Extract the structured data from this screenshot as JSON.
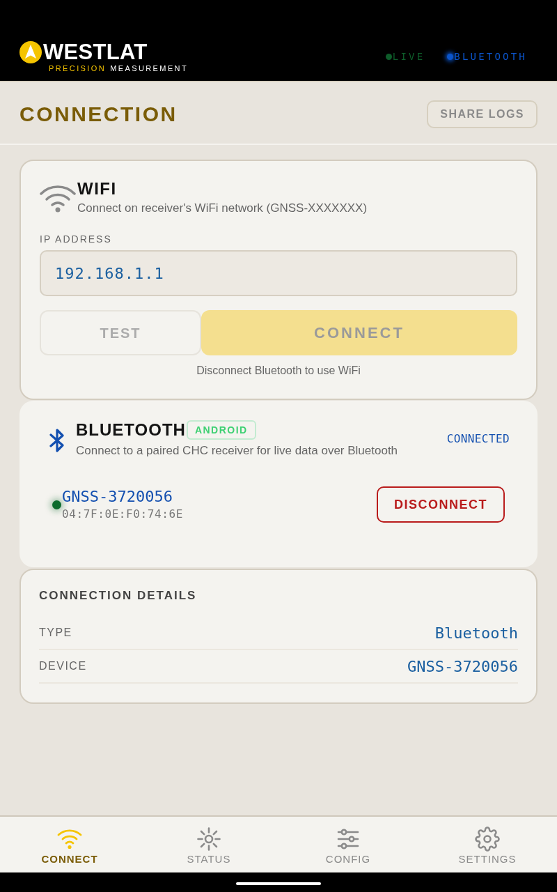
{
  "header": {
    "brand": "WESTLAT",
    "tagline": [
      {
        "text": "PRECISION",
        "accent": true
      },
      {
        "text": "MEASUREMENT",
        "accent": false
      }
    ],
    "indicators": [
      {
        "label": "LIVE",
        "color": "#0e5c2a",
        "active": false
      },
      {
        "label": "BLUETOOTH",
        "color": "#0b55cc",
        "active": true
      }
    ]
  },
  "page": {
    "title": "CONNECTION",
    "share_button": "SHARE LOGS"
  },
  "wifi": {
    "title": "WIFI",
    "description": "Connect on receiver's WiFi network (GNSS-XXXXXXX)",
    "field": {
      "label": "IP ADDRESS",
      "value": "192.168.1.1"
    },
    "buttons": [
      {
        "label": "TEST",
        "kind": "secondary",
        "disabled": true
      },
      {
        "label": "CONNECT",
        "kind": "primary",
        "disabled": true
      }
    ],
    "note": "Disconnect Bluetooth to use WiFi"
  },
  "bluetooth": {
    "title": "BLUETOOTH",
    "badge": "ANDROID",
    "description": "Connect to a paired CHC receiver for live data over Bluetooth",
    "status": "CONNECTED",
    "device": {
      "name": "GNSS-3720056",
      "address": "04:7F:0E:F0:74:6E",
      "connected": true,
      "button": "DISCONNECT"
    }
  },
  "details": {
    "title": "CONNECTION DETAILS",
    "rows": [
      {
        "label": "TYPE",
        "value": "Bluetooth"
      },
      {
        "label": "DEVICE",
        "value": "GNSS-3720056"
      }
    ]
  },
  "nav": {
    "items": [
      {
        "label": "CONNECT",
        "kind": "wifi",
        "selected": true
      },
      {
        "label": "STATUS",
        "kind": "status",
        "selected": false
      },
      {
        "label": "CONFIG",
        "kind": "config",
        "selected": false
      },
      {
        "label": "SETTINGS",
        "kind": "settings",
        "selected": false
      }
    ]
  }
}
